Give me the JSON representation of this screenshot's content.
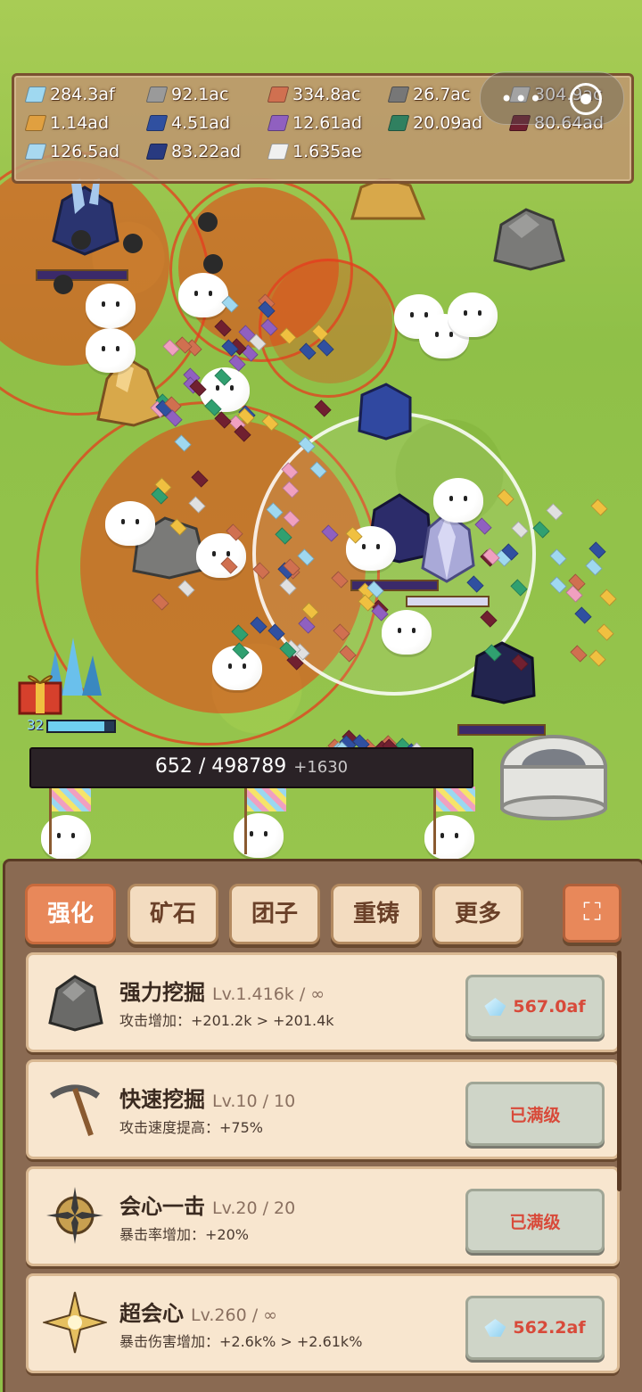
{
  "resources": [
    {
      "icon": "diamond-icon",
      "value": "284.3af",
      "color": "#9fd8f0"
    },
    {
      "icon": "iron-ingot-icon",
      "value": "92.1ac",
      "color": "#9a9a9a"
    },
    {
      "icon": "copper-ingot-icon",
      "value": "334.8ac",
      "color": "#d07050"
    },
    {
      "icon": "lead-ingot-icon",
      "value": "26.7ac",
      "color": "#777777"
    },
    {
      "icon": "silver-ingot-icon",
      "value": "304.9ac",
      "color": "#cfcfcf"
    },
    {
      "icon": "gold-ingot-icon",
      "value": "1.14ad",
      "color": "#e0a040"
    },
    {
      "icon": "sapphire-ingot-icon",
      "value": "4.51ad",
      "color": "#3050a0"
    },
    {
      "icon": "amethyst-ingot-icon",
      "value": "12.61ad",
      "color": "#9060c0"
    },
    {
      "icon": "emerald-ingot-icon",
      "value": "20.09ad",
      "color": "#308060"
    },
    {
      "icon": "ruby-ingot-icon",
      "value": "80.64ad",
      "color": "#702030"
    },
    {
      "icon": "crystal-ingot-icon",
      "value": "126.5ad",
      "color": "#a8d8f0"
    },
    {
      "icon": "cobalt-ingot-icon",
      "value": "83.22ad",
      "color": "#283a80"
    },
    {
      "icon": "platinum-ingot-icon",
      "value": "1.635ae",
      "color": "#f0f0f0"
    }
  ],
  "miniprogram": {
    "menu": "•••",
    "close": "◉"
  },
  "level": {
    "value": "32",
    "fill": 0.85
  },
  "progress": {
    "current": "652",
    "total": "498789",
    "text": "652 / 498789",
    "gain": "+1630"
  },
  "tabs": [
    {
      "label": "强化",
      "active": true
    },
    {
      "label": "矿石",
      "active": false
    },
    {
      "label": "团子",
      "active": false
    },
    {
      "label": "重铸",
      "active": false
    },
    {
      "label": "更多",
      "active": false
    }
  ],
  "expand_icon": "⛶",
  "upgrades": [
    {
      "icon": "rock-pile-icon",
      "title": "强力挖掘",
      "level": "Lv.1.416k / ∞",
      "desc": "攻击增加：+201.2k > +201.4k",
      "button": "567.0af",
      "maxed": false
    },
    {
      "icon": "pickaxe-icon",
      "title": "快速挖掘",
      "level": "Lv.10 / 10",
      "desc": "攻击速度提高：+75%",
      "button": "已满级",
      "maxed": true
    },
    {
      "icon": "crit-target-icon",
      "title": "会心一击",
      "level": "Lv.20 / 20",
      "desc": "暴击率增加：+20%",
      "button": "已满级",
      "maxed": true
    },
    {
      "icon": "super-crit-icon",
      "title": "超会心",
      "level": "Lv.260 / ∞",
      "desc": "暴击伤害增加：+2.6k% > +2.61k%",
      "button": "562.2af",
      "maxed": false
    }
  ]
}
